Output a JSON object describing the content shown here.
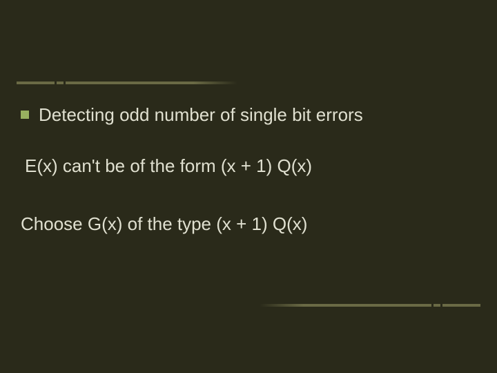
{
  "slide": {
    "bullet1": "Detecting odd number of single bit errors",
    "line2": "E(x) can't be of the form (x + 1) Q(x)",
    "line3": "Choose G(x) of the type (x + 1) Q(x)"
  }
}
